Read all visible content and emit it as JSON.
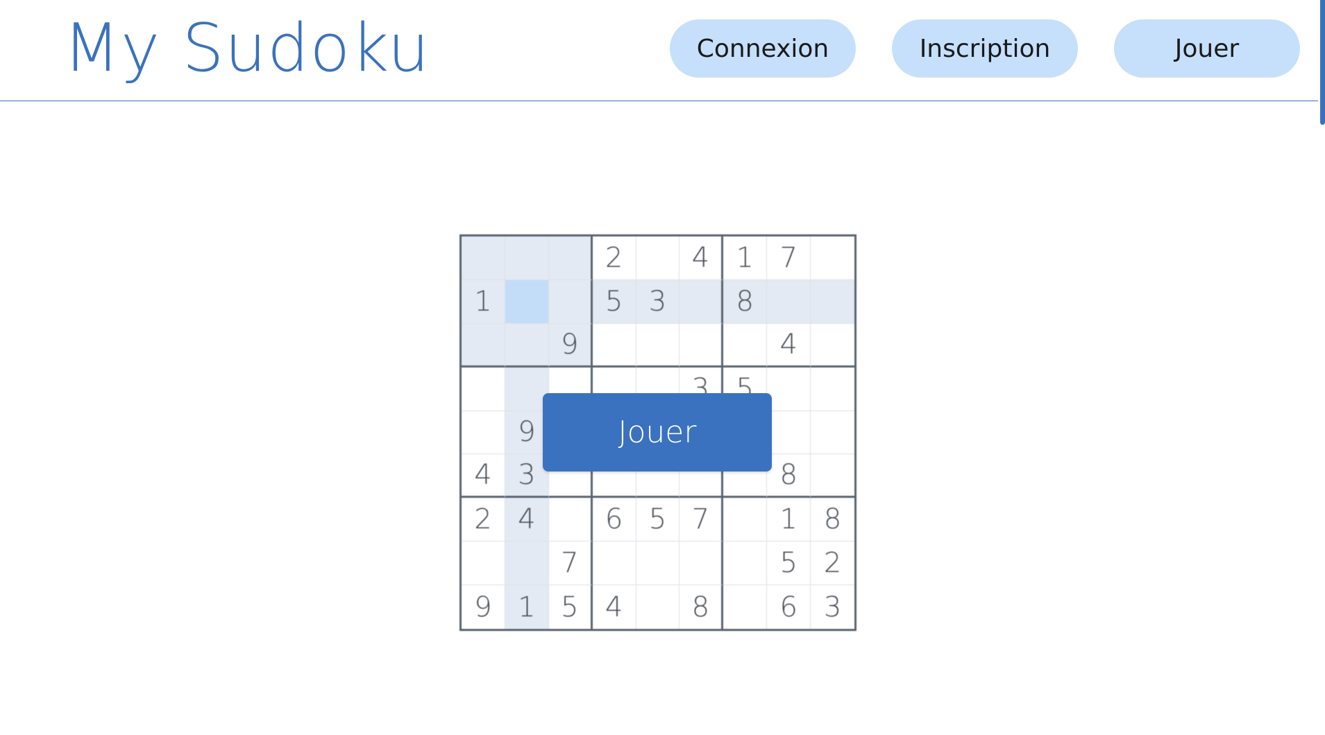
{
  "header": {
    "title": "My Sudoku",
    "nav": [
      {
        "label": "Connexion",
        "name": "connexion-button"
      },
      {
        "label": "Inscription",
        "name": "inscription-button"
      },
      {
        "label": "Jouer",
        "name": "jouer-nav-button"
      }
    ]
  },
  "colors": {
    "brand": "#3a72bd",
    "nav_button_bg": "#c6e0fb",
    "play_button_bg": "#3a72c0",
    "cell_highlight": "#e4eaf3",
    "cell_selected": "#c3dcf8"
  },
  "board": {
    "rows": [
      [
        "",
        "",
        "",
        "2",
        "",
        "4",
        "1",
        "7",
        ""
      ],
      [
        "1",
        "",
        "",
        "5",
        "3",
        "",
        "8",
        "",
        ""
      ],
      [
        "",
        "",
        "9",
        "",
        "",
        "",
        "",
        "4",
        ""
      ],
      [
        "",
        "",
        "",
        "",
        "",
        "3",
        "5",
        "",
        ""
      ],
      [
        "",
        "9",
        "",
        "",
        "",
        "",
        "",
        "",
        ""
      ],
      [
        "4",
        "3",
        "",
        "",
        "",
        "",
        "",
        "8",
        ""
      ],
      [
        "2",
        "4",
        "",
        "6",
        "5",
        "7",
        "",
        "1",
        "8"
      ],
      [
        "",
        "",
        "7",
        "",
        "",
        "",
        "",
        "5",
        "2"
      ],
      [
        "9",
        "1",
        "5",
        "4",
        "",
        "8",
        "",
        "6",
        "3"
      ]
    ],
    "selected": {
      "row": 1,
      "col": 1
    }
  },
  "play_button": {
    "label": "Jouer"
  },
  "bottom_text": ""
}
